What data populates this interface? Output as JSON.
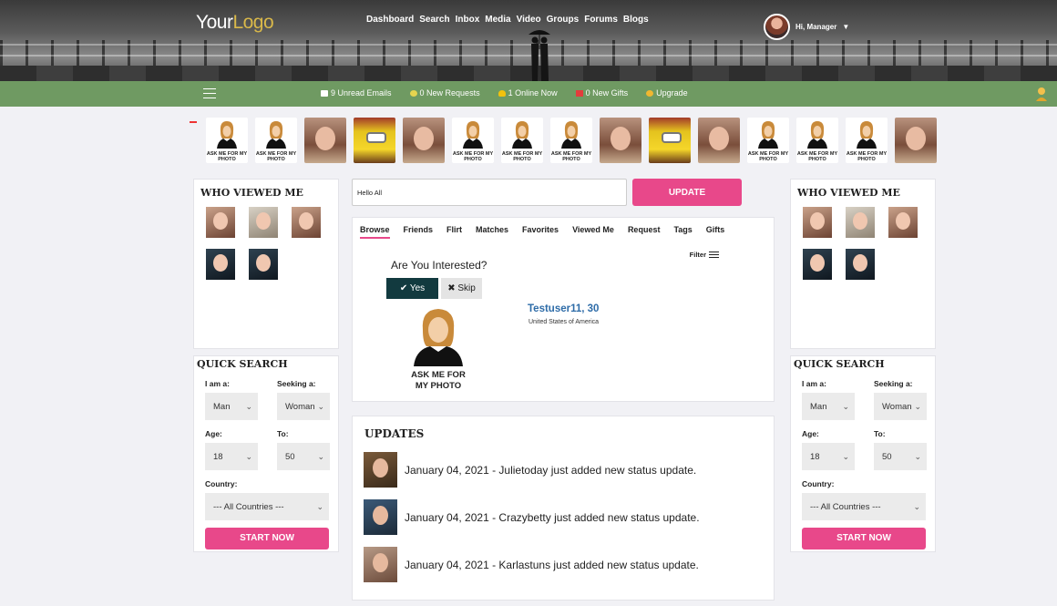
{
  "header": {
    "logo_main": "Your",
    "logo_accent": "Logo",
    "nav": [
      "Dashboard",
      "Search",
      "Inbox",
      "Media",
      "Video",
      "Groups",
      "Forums",
      "Blogs"
    ],
    "user_greeting": "Hi, Manager"
  },
  "notifications": {
    "emails": "9 Unread Emails",
    "requests": "0 New Requests",
    "online": "1 Online Now",
    "gifts": "0 New Gifts",
    "upgrade": "Upgrade"
  },
  "strip": {
    "ask_text": "ASK ME FOR MY PHOTO",
    "thumbs": [
      "ask",
      "ask",
      "photo",
      "toon",
      "photo",
      "ask",
      "ask",
      "ask",
      "photo",
      "toon",
      "photo",
      "ask",
      "ask",
      "ask",
      "photo"
    ]
  },
  "left": {
    "viewed_title": "WHO VIEWED ME",
    "qs_title": "QUICK SEARCH"
  },
  "right": {
    "viewed_title": "WHO VIEWED ME",
    "qs_title": "QUICK SEARCH"
  },
  "quick_search": {
    "i_am_label": "I am a:",
    "i_am_value": "Man",
    "seeking_label": "Seeking a:",
    "seeking_value": "Woman",
    "age_label": "Age:",
    "age_value": "18",
    "to_label": "To:",
    "to_value": "50",
    "country_label": "Country:",
    "country_value": "--- All Countries ---",
    "start_label": "START NOW"
  },
  "status": {
    "value": "Hello All",
    "update_label": "UPDATE"
  },
  "tabs": [
    "Browse",
    "Friends",
    "Flirt",
    "Matches",
    "Favorites",
    "Viewed Me",
    "Request",
    "Tags",
    "Gifts"
  ],
  "browse": {
    "filter_label": "Filter",
    "question": "Are You Interested?",
    "yes_label": "Yes",
    "skip_label": "Skip",
    "ask_line1": "ASK ME FOR",
    "ask_line2": "MY PHOTO",
    "match_name": "Testuser11, 30",
    "match_country": "United States of America"
  },
  "updates": {
    "title": "UPDATES",
    "items": [
      "January 04, 2021 - Julietoday  just added new status update.",
      "January 04, 2021 - Crazybetty  just added new status update.",
      "January 04, 2021 - Karlastuns  just added new status update."
    ]
  },
  "colors": {
    "accent_pink": "#e8488a",
    "green_bar": "#6f9a62",
    "link_blue": "#2e6ca8",
    "dark_teal": "#123a3f"
  }
}
